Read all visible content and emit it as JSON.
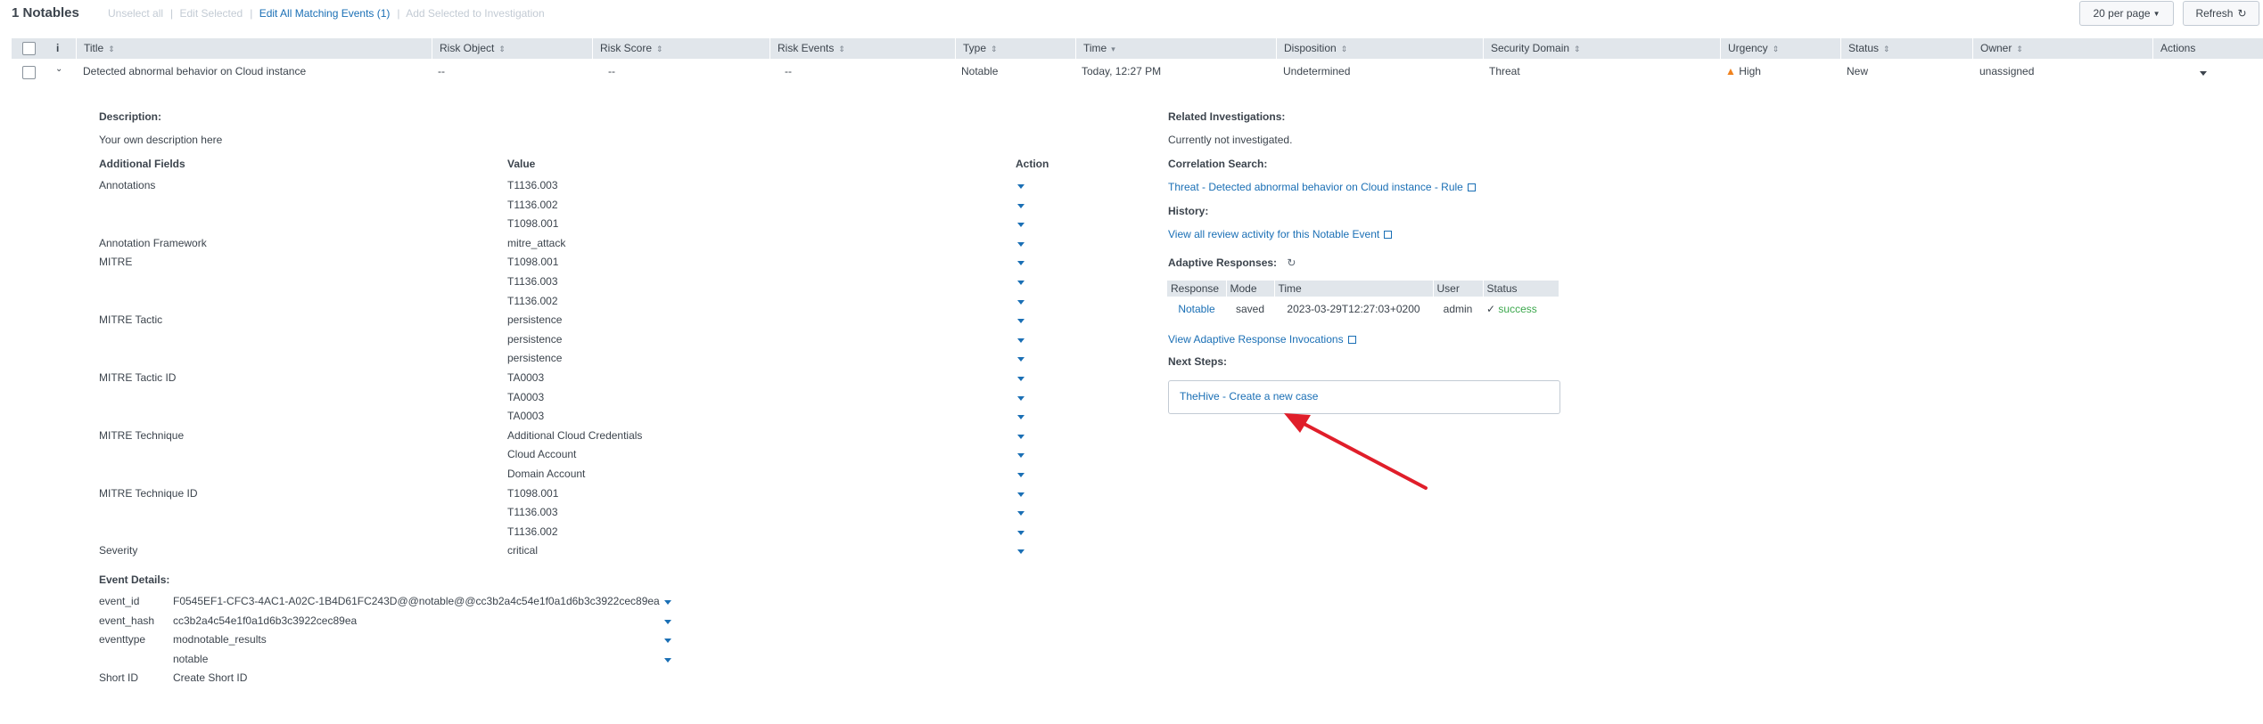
{
  "toolbar": {
    "count": "1 Notables",
    "unselect_all": "Unselect all",
    "edit_selected": "Edit Selected",
    "edit_all": "Edit All Matching Events (1)",
    "add_investigation": "Add Selected to Investigation",
    "per_page": "20 per page",
    "refresh": "Refresh"
  },
  "columns": {
    "info": "i",
    "title": "Title",
    "risk_object": "Risk Object",
    "risk_score": "Risk Score",
    "risk_events": "Risk Events",
    "type": "Type",
    "time": "Time",
    "disposition": "Disposition",
    "security_domain": "Security Domain",
    "urgency": "Urgency",
    "status": "Status",
    "owner": "Owner",
    "actions": "Actions"
  },
  "row": {
    "title": "Detected abnormal behavior on Cloud instance",
    "risk_object": "--",
    "risk_score": "--",
    "risk_events": "--",
    "type": "Notable",
    "time": "Today, 12:27 PM",
    "disposition": "Undetermined",
    "security_domain": "Threat",
    "urgency": "High",
    "status": "New",
    "owner": "unassigned"
  },
  "details": {
    "description_label": "Description:",
    "description": "Your own description here",
    "fields_header": "Additional Fields",
    "value_header": "Value",
    "action_header": "Action",
    "fields": [
      {
        "name": "Annotations",
        "value": "T1136.003"
      },
      {
        "name": "",
        "value": "T1136.002"
      },
      {
        "name": "",
        "value": "T1098.001"
      },
      {
        "name": "Annotation Framework",
        "value": "mitre_attack"
      },
      {
        "name": "MITRE",
        "value": "T1098.001"
      },
      {
        "name": "",
        "value": "T1136.003"
      },
      {
        "name": "",
        "value": "T1136.002"
      },
      {
        "name": "MITRE Tactic",
        "value": "persistence"
      },
      {
        "name": "",
        "value": "persistence"
      },
      {
        "name": "",
        "value": "persistence"
      },
      {
        "name": "MITRE Tactic ID",
        "value": "TA0003"
      },
      {
        "name": "",
        "value": "TA0003"
      },
      {
        "name": "",
        "value": "TA0003"
      },
      {
        "name": "MITRE Technique",
        "value": "Additional Cloud Credentials"
      },
      {
        "name": "",
        "value": "Cloud Account"
      },
      {
        "name": "",
        "value": "Domain Account"
      },
      {
        "name": "MITRE Technique ID",
        "value": "T1098.001"
      },
      {
        "name": "",
        "value": "T1136.003"
      },
      {
        "name": "",
        "value": "T1136.002"
      },
      {
        "name": "Severity",
        "value": "critical"
      }
    ],
    "event_details_label": "Event Details:",
    "event_fields": [
      {
        "name": "event_id",
        "value": "F0545EF1-CFC3-4AC1-A02C-1B4D61FC243D@@notable@@cc3b2a4c54e1f0a1d6b3c3922cec89ea"
      },
      {
        "name": "event_hash",
        "value": "cc3b2a4c54e1f0a1d6b3c3922cec89ea"
      },
      {
        "name": "eventtype",
        "value": "modnotable_results"
      },
      {
        "name": "",
        "value": "notable"
      }
    ],
    "short_id_label": "Short ID",
    "short_id_link": "Create Short ID"
  },
  "right": {
    "related_label": "Related Investigations:",
    "related_value": "Currently not investigated.",
    "correlation_label": "Correlation Search:",
    "correlation_link": "Threat - Detected abnormal behavior on Cloud instance - Rule",
    "history_label": "History:",
    "history_link": "View all review activity for this Notable Event",
    "adaptive_label": "Adaptive Responses:",
    "ar_headers": [
      "Response",
      "Mode",
      "Time",
      "User",
      "Status"
    ],
    "ar_row": {
      "response": "Notable",
      "mode": "saved",
      "time": "2023-03-29T12:27:03+0200",
      "user": "admin",
      "status": "success"
    },
    "ar_invocations_link": "View Adaptive Response Invocations",
    "next_steps_label": "Next Steps:",
    "next_step_link": "TheHive - Create a new case"
  },
  "colors": {
    "link": "#1a6fb5",
    "header_bg": "#e1e6eb",
    "success": "#3ca84d",
    "urgency_high": "#f0821e",
    "annotation_arrow": "#e01e2a"
  }
}
